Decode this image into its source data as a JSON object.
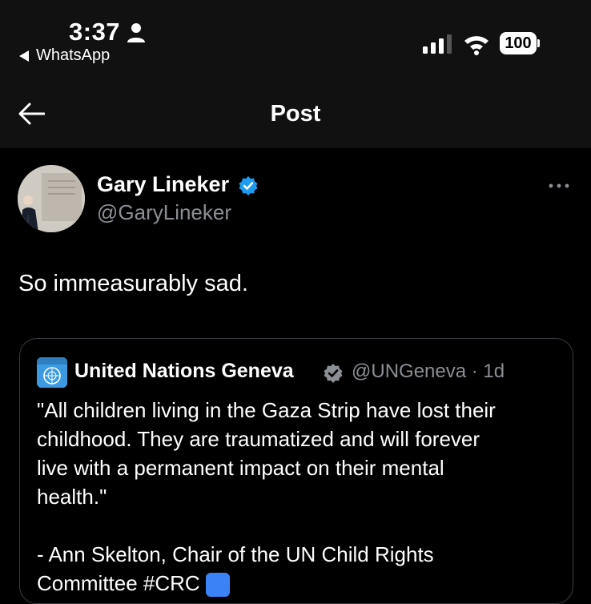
{
  "status_bar": {
    "time": "3:37",
    "back_app": "WhatsApp",
    "battery": "100"
  },
  "nav": {
    "title": "Post"
  },
  "post": {
    "author_name": "Gary Lineker",
    "handle": "@GaryLineker",
    "text": "So immeasurably sad."
  },
  "quote": {
    "name": "United Nations Geneva",
    "handle_time": "@UNGeneva · 1d",
    "line1": "\"All children living in the Gaza Strip have lost their",
    "line2": "childhood. They are traumatized and will forever",
    "line3": "live with a permanent impact on their mental",
    "line4": "health.\"",
    "line5": "- Ann Skelton, Chair of the UN Child Rights",
    "line6": "Committee #CRC"
  },
  "colors": {
    "verified": "#1d9bf0",
    "background": "#000000",
    "secondary_text": "#8b8f94"
  }
}
